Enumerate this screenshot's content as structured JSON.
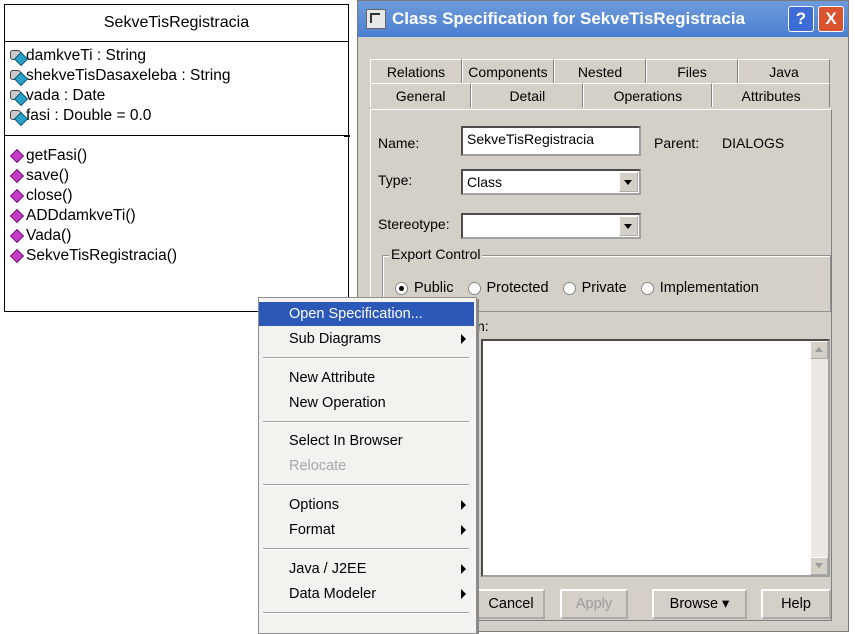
{
  "uml_class": {
    "name": "SekveTisRegistracia",
    "attributes": [
      "damkveTi : String",
      "shekveTisDasaxeleba : String",
      "vada : Date",
      "fasi : Double = 0.0"
    ],
    "operations": [
      "getFasi()",
      "save()",
      "close()",
      "ADDdamkveTi()",
      "Vada()",
      "SekveTisRegistracia()"
    ]
  },
  "dialog": {
    "title": "Class Specification for SekveTisRegistracia",
    "help_button": "?",
    "close_button": "X",
    "tabs_row1": [
      "Relations",
      "Components",
      "Nested",
      "Files",
      "Java"
    ],
    "tabs_row2": [
      "General",
      "Detail",
      "Operations",
      "Attributes"
    ],
    "active_tab": "General",
    "name_label": "Name:",
    "name_value": "SekveTisRegistracia",
    "parent_label": "Parent:",
    "parent_value": "DIALOGS",
    "type_label": "Type:",
    "type_value": "Class",
    "stereotype_label": "Stereotype:",
    "stereotype_value": "",
    "export_label": "Export Control",
    "export_options": [
      "Public",
      "Protected",
      "Private",
      "Implementation"
    ],
    "export_selected": "Public",
    "documentation_label_partial": "n:",
    "buttons": {
      "cancel": "Cancel",
      "apply": "Apply",
      "browse": "Browse ▾",
      "help": "Help"
    }
  },
  "context_menu": {
    "items": [
      {
        "label": "Open Specification...",
        "highlighted": true
      },
      {
        "label": "Sub Diagrams",
        "submenu": true
      },
      {
        "label": "New Attribute"
      },
      {
        "label": "New Operation"
      },
      {
        "label": "Select In Browser"
      },
      {
        "label": "Relocate",
        "disabled": true
      },
      {
        "label": "Options",
        "submenu": true
      },
      {
        "label": "Format",
        "submenu": true
      },
      {
        "label": "Java / J2EE",
        "submenu": true
      },
      {
        "label": "Data Modeler",
        "submenu": true
      }
    ]
  }
}
